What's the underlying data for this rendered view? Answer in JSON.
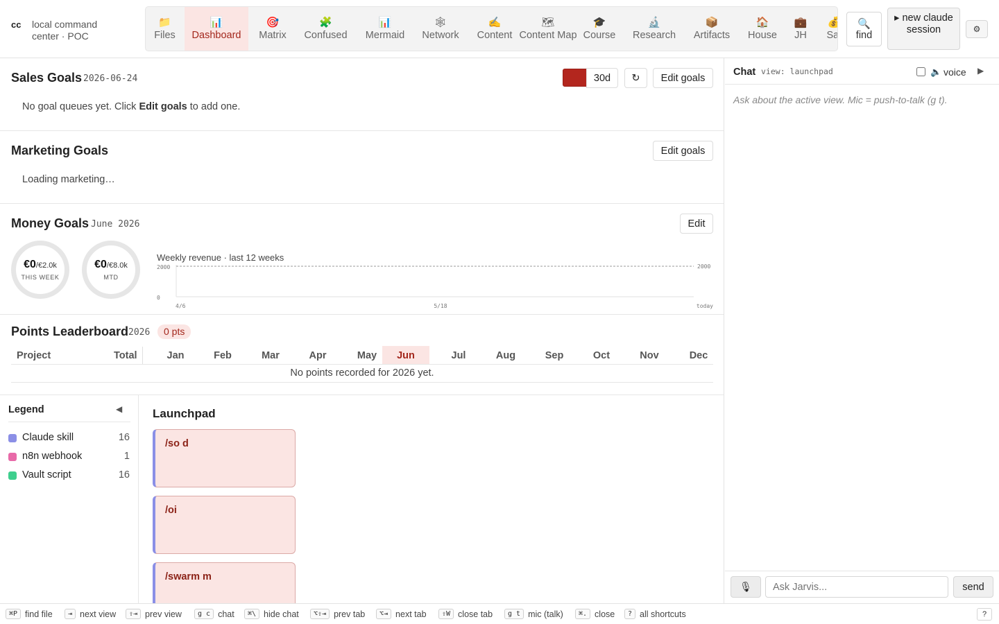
{
  "brand": {
    "short": "cc",
    "subtitle": "local command center · POC"
  },
  "tabs": [
    {
      "icon": "📁",
      "label": "Files"
    },
    {
      "icon": "📊",
      "label": "Dashboard"
    },
    {
      "icon": "🎯",
      "label": "Matrix"
    },
    {
      "icon": "🧩",
      "label": "Confused"
    },
    {
      "icon": "📊",
      "label": "Mermaid"
    },
    {
      "icon": "🕸",
      "label": "Network"
    },
    {
      "icon": "✍",
      "label": "Content"
    },
    {
      "icon": "🗺",
      "label": "Content Map"
    },
    {
      "icon": "🎓",
      "label": "Course"
    },
    {
      "icon": "🔬",
      "label": "Research"
    },
    {
      "icon": "📦",
      "label": "Artifacts"
    },
    {
      "icon": "🏠",
      "label": "House"
    },
    {
      "icon": "💼",
      "label": "JH"
    },
    {
      "icon": "💰",
      "label": "Sal"
    }
  ],
  "active_tab": "Dashboard",
  "toolbar": {
    "find_icon": "🔍",
    "find_label": "find",
    "new_session_label": "▸ new claude session",
    "settings_icon": "⚙"
  },
  "sales": {
    "title": "Sales Goals",
    "date": "2026-06-24",
    "swatch_color": "#b3261e",
    "range_label": "30d",
    "refresh_icon": "↻",
    "edit_label": "Edit goals",
    "empty_prefix": "No goal queues yet. Click ",
    "empty_link": "Edit goals",
    "empty_suffix": " to add one."
  },
  "marketing": {
    "title": "Marketing Goals",
    "edit_label": "Edit goals",
    "loading": "Loading marketing…"
  },
  "money": {
    "title": "Money Goals",
    "period": "June 2026",
    "edit_label": "Edit",
    "rings": [
      {
        "value": "€0",
        "target": "/€2.0k",
        "label": "THIS WEEK",
        "progress": 0
      },
      {
        "value": "€0",
        "target": "/€8.0k",
        "label": "MTD",
        "progress": 0
      }
    ]
  },
  "chart_data": {
    "type": "line",
    "title": "Weekly revenue · last 12 weeks",
    "x_labels": [
      "4/6",
      "5/18",
      "today"
    ],
    "y_ticks": [
      0,
      2000
    ],
    "goal_line": 2000,
    "goal_label": "2000",
    "ylim": [
      0,
      2000
    ],
    "series": [
      {
        "values": []
      }
    ]
  },
  "leaderboard": {
    "title": "Points Leaderboard",
    "year": "2026",
    "points_badge": "0 pts",
    "col_project": "Project",
    "col_total": "Total",
    "months": [
      "Jan",
      "Feb",
      "Mar",
      "Apr",
      "May",
      "Jun",
      "Jul",
      "Aug",
      "Sep",
      "Oct",
      "Nov",
      "Dec"
    ],
    "current_month": "Jun",
    "empty": "No points recorded for 2026 yet."
  },
  "legend": {
    "title": "Legend",
    "collapse_icon": "◀",
    "items": [
      {
        "label": "Claude skill",
        "count": "16",
        "color": "#8b8fe6"
      },
      {
        "label": "n8n webhook",
        "count": "1",
        "color": "#e86aa8"
      },
      {
        "label": "Vault script",
        "count": "16",
        "color": "#3fcf8e"
      }
    ]
  },
  "launchpad": {
    "title": "Launchpad",
    "cards": [
      "/so d",
      "/oi",
      "/swarm m"
    ]
  },
  "chat": {
    "title": "Chat",
    "view_label": "view: launchpad",
    "voice_icon": "🔈",
    "voice_label": "voice",
    "play_icon": "▶",
    "hint": "Ask about the active view. Mic = push-to-talk (g t).",
    "mic_icon": "🎙",
    "placeholder": "Ask Jarvis...",
    "send_label": "send"
  },
  "shortcuts": [
    {
      "keys": "⌘P",
      "label": "find file"
    },
    {
      "keys": "⇥",
      "label": "next view"
    },
    {
      "keys": "⇧⇥",
      "label": "prev view"
    },
    {
      "keys": "g c",
      "label": "chat"
    },
    {
      "keys": "⌘\\",
      "label": "hide chat"
    },
    {
      "keys": "⌥⇧⇥",
      "label": "prev tab"
    },
    {
      "keys": "⌥⇥",
      "label": "next tab"
    },
    {
      "keys": "⇧W",
      "label": "close tab"
    },
    {
      "keys": "g t",
      "label": "mic (talk)"
    },
    {
      "keys": "⌘.",
      "label": "close"
    },
    {
      "keys": "?",
      "label": "all shortcuts"
    }
  ],
  "help_label": "?"
}
